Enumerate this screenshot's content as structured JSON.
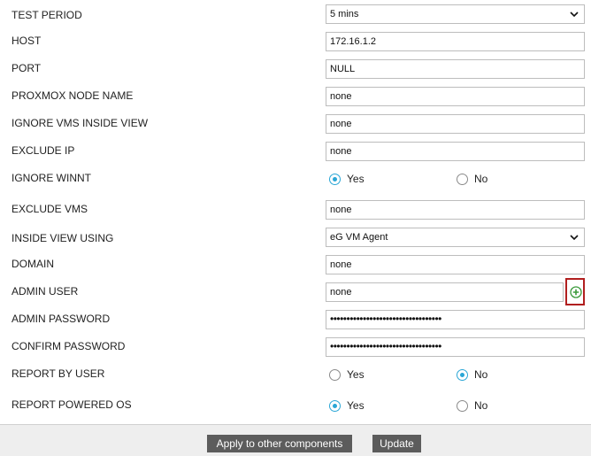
{
  "form": {
    "test_period": {
      "label": "TEST PERIOD",
      "value": "5 mins"
    },
    "host": {
      "label": "HOST",
      "value": "172.16.1.2"
    },
    "port": {
      "label": "PORT",
      "value": "NULL"
    },
    "proxmox_node_name": {
      "label": "PROXMOX NODE NAME",
      "value": "none"
    },
    "ignore_vms_inside_view": {
      "label": "IGNORE VMS INSIDE VIEW",
      "value": "none"
    },
    "exclude_ip": {
      "label": "EXCLUDE IP",
      "value": "none"
    },
    "ignore_winnt": {
      "label": "IGNORE WINNT",
      "yes": "Yes",
      "no": "No",
      "selected": "Yes"
    },
    "exclude_vms": {
      "label": "EXCLUDE VMS",
      "value": "none"
    },
    "inside_view_using": {
      "label": "INSIDE VIEW USING",
      "value": "eG VM Agent"
    },
    "domain": {
      "label": "DOMAIN",
      "value": "none"
    },
    "admin_user": {
      "label": "ADMIN USER",
      "value": "none"
    },
    "admin_password": {
      "label": "ADMIN PASSWORD",
      "value": "••••••••••••••••••••••••••••••••••"
    },
    "confirm_password": {
      "label": "CONFIRM PASSWORD",
      "value": "••••••••••••••••••••••••••••••••••"
    },
    "report_by_user": {
      "label": "REPORT BY USER",
      "yes": "Yes",
      "no": "No",
      "selected": "No"
    },
    "report_powered_os": {
      "label": "REPORT POWERED OS",
      "yes": "Yes",
      "no": "No",
      "selected": "Yes"
    }
  },
  "footer": {
    "apply_label": "Apply to other components",
    "update_label": "Update"
  },
  "colors": {
    "radio_checked": "#2aa6d6",
    "button_bg": "#5c5c5c",
    "highlight_border": "#b11f1f",
    "add_icon": "#3a9a3a"
  }
}
